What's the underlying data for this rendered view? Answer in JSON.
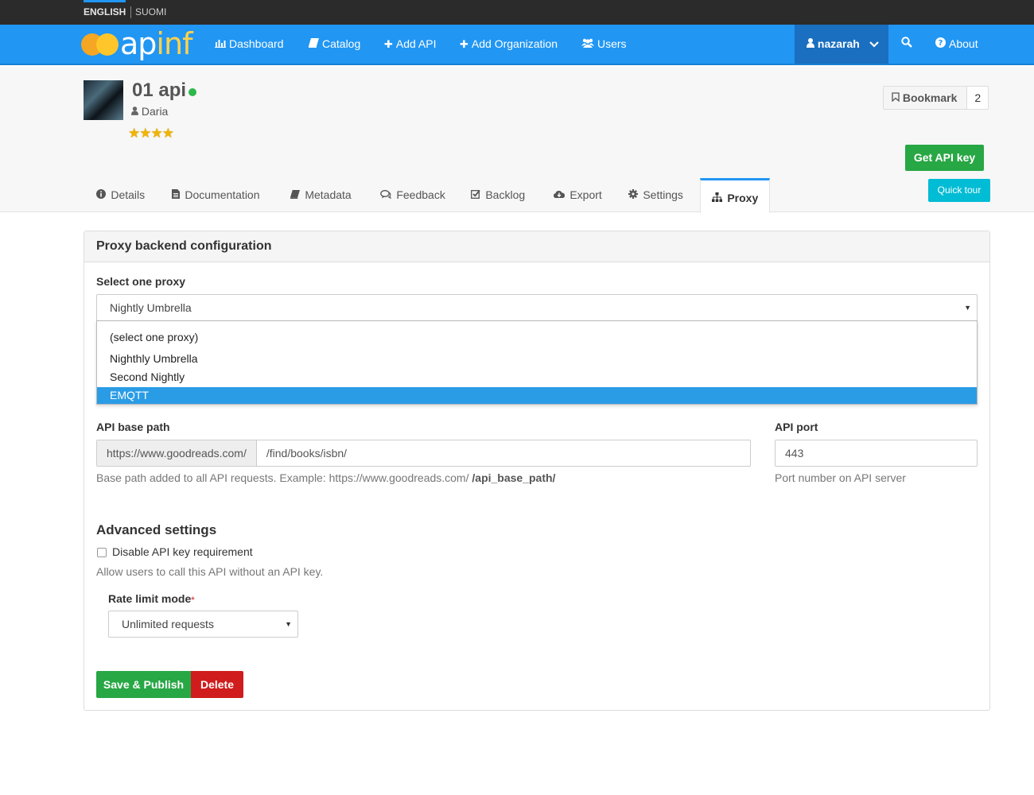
{
  "lang": {
    "english": "ENGLISH",
    "suomi": "SUOMI"
  },
  "brand": {
    "logo_text_a": "ap",
    "logo_text_b": "inf"
  },
  "nav": {
    "dashboard": "Dashboard",
    "catalog": "Catalog",
    "add_api": "Add API",
    "add_org": "Add Organization",
    "users": "Users",
    "user": "nazarah",
    "about": "About"
  },
  "api": {
    "title": "01 api",
    "author": "Daria",
    "rating_stars": "★★★★",
    "rating": 4,
    "status_color": "#2eb84b"
  },
  "actions": {
    "bookmark": "Bookmark",
    "bookmark_count": "2",
    "get_api_key": "Get API key",
    "quick_tour": "Quick tour"
  },
  "tabs": {
    "details": "Details",
    "documentation": "Documentation",
    "metadata": "Metadata",
    "feedback": "Feedback",
    "backlog": "Backlog",
    "export": "Export",
    "settings": "Settings",
    "proxy": "Proxy"
  },
  "panel": {
    "heading": "Proxy backend configuration",
    "select_proxy_label": "Select one proxy",
    "select_proxy_value": "Nightly Umbrella",
    "proxy_options": [
      "(select one proxy)",
      "Nighthly Umbrella",
      "Second Nightly",
      "EMQTT"
    ],
    "selected_option_index": 3,
    "base_path_label": "API base path",
    "base_path_prefix": "https://www.goodreads.com/",
    "base_path_value": "/find/books/isbn/",
    "base_path_help_a": "Base path added to all API requests. Example:  https://www.goodreads.com/ ",
    "base_path_help_b": "/api_base_path/",
    "port_label": "API port",
    "port_value": "443",
    "port_help": "Port number on API server",
    "advanced_heading": "Advanced settings",
    "disable_key_label": "Disable API key requirement",
    "disable_key_checked": false,
    "disable_key_help": "Allow users to call this API without an API key.",
    "rate_limit_label": "Rate limit mode",
    "rate_limit_required": "*",
    "rate_limit_value": "Unlimited requests",
    "save_button": "Save & Publish",
    "delete_button": "Delete"
  },
  "colors": {
    "primary": "#2196f3",
    "success": "#28a745",
    "danger": "#d01c1c",
    "info": "#00bcd4",
    "dropdown_highlight": "#2a9ce6"
  }
}
